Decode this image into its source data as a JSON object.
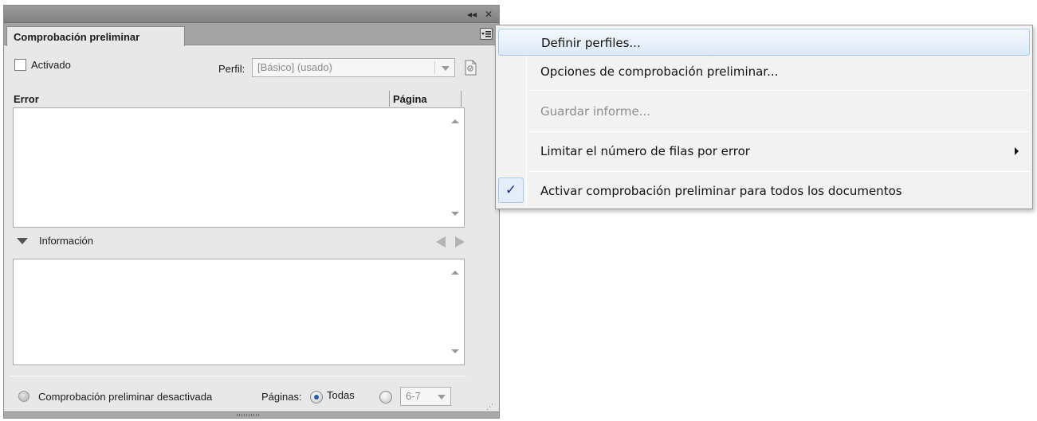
{
  "panel": {
    "collapse_glyph": "◂◂",
    "close_glyph": "✕",
    "tab_title": "Comprobación preliminar",
    "enabled_label": "Activado",
    "profile_label": "Perfil:",
    "profile_value": "[Básico] (usado)",
    "error_column": "Error",
    "page_column": "Página",
    "info_label": "Información",
    "status_text": "Comprobación preliminar desactivada",
    "pages_label": "Páginas:",
    "pages_all_label": "Todas",
    "pages_range_value": "6-7"
  },
  "menu": {
    "items": [
      {
        "label": "Definir perfiles...",
        "state": "hover"
      },
      {
        "label": "Opciones de comprobación preliminar...",
        "state": "normal"
      },
      {
        "label": "Guardar informe...",
        "state": "disabled"
      },
      {
        "label": "Limitar el número de filas por error",
        "state": "submenu"
      },
      {
        "label": "Activar comprobación preliminar para todos los documentos",
        "state": "checked"
      }
    ],
    "check_glyph": "✓"
  },
  "colors": {
    "menu_highlight": "#dde9f8",
    "checkmark": "#1a2f8a",
    "radio_selected": "#1d5ea8"
  }
}
